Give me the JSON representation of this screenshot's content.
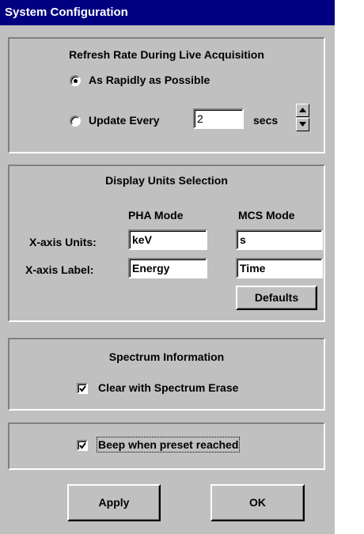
{
  "window": {
    "title": "System Configuration"
  },
  "refresh": {
    "title": "Refresh Rate During Live Acquisition",
    "option_rapid": "As Rapidly as Possible",
    "option_update": "Update Every",
    "update_value": "2",
    "units": "secs",
    "selected": "rapid"
  },
  "display": {
    "title": "Display Units Selection",
    "pha_header": "PHA Mode",
    "mcs_header": "MCS Mode",
    "xunits_label": "X-axis Units:",
    "xlabel_label": "X-axis Label:",
    "pha_units": "keV",
    "mcs_units": "s",
    "pha_label": "Energy",
    "mcs_label": "Time",
    "defaults_button": "Defaults"
  },
  "spectrum": {
    "title": "Spectrum Information",
    "clear_label": "Clear with Spectrum Erase",
    "clear_checked": true
  },
  "beep": {
    "label": "Beep when preset reached",
    "checked": true
  },
  "buttons": {
    "apply": "Apply",
    "ok": "OK"
  }
}
